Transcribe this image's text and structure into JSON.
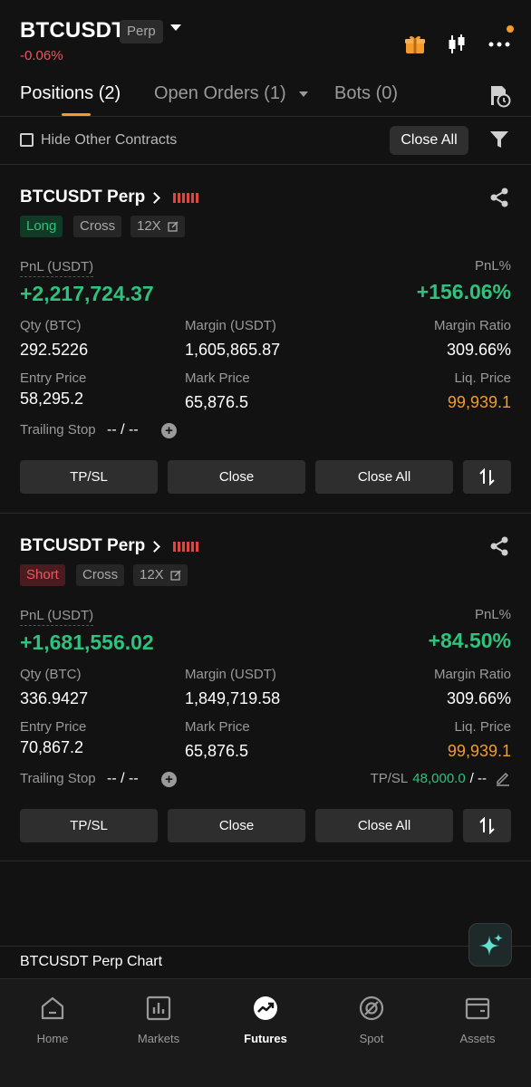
{
  "header": {
    "symbol": "BTCUSDT",
    "perp_badge": "Perp",
    "change": "-0.06%",
    "icons": [
      "gift-icon",
      "candlestick-icon",
      "more-icon"
    ]
  },
  "tabs": [
    {
      "label": "Positions (2)",
      "active": true
    },
    {
      "label": "Open Orders (1)",
      "active": false
    },
    {
      "label": "Bots (0)",
      "active": false
    }
  ],
  "filter": {
    "hide_label": "Hide Other Contracts",
    "close_all": "Close All"
  },
  "positions": [
    {
      "title": "BTCUSDT Perp",
      "side": "Long",
      "margin_mode": "Cross",
      "leverage": "12X",
      "pnl_label": "PnL (USDT)",
      "pnl": "+2,217,724.37",
      "pnl_pct_label": "PnL%",
      "pnl_pct": "+156.06%",
      "qty_label": "Qty (BTC)",
      "qty": "292.5226",
      "margin_label": "Margin (USDT)",
      "margin": "1,605,865.87",
      "margin_ratio_label": "Margin Ratio",
      "margin_ratio": "309.66%",
      "entry_label": "Entry Price",
      "entry": "58,295.2",
      "mark_label": "Mark Price",
      "mark": "65,876.5",
      "liq_label": "Liq. Price",
      "liq": "99,939.1",
      "trailing_label": "Trailing Stop",
      "trailing_value": "-- / --",
      "tpsl_label": "",
      "tpsl_tp": "",
      "tpsl_sl": "",
      "buttons": {
        "tpsl": "TP/SL",
        "close": "Close",
        "close_all": "Close All"
      }
    },
    {
      "title": "BTCUSDT Perp",
      "side": "Short",
      "margin_mode": "Cross",
      "leverage": "12X",
      "pnl_label": "PnL (USDT)",
      "pnl": "+1,681,556.02",
      "pnl_pct_label": "PnL%",
      "pnl_pct": "+84.50%",
      "qty_label": "Qty (BTC)",
      "qty": "336.9427",
      "margin_label": "Margin (USDT)",
      "margin": "1,849,719.58",
      "margin_ratio_label": "Margin Ratio",
      "margin_ratio": "309.66%",
      "entry_label": "Entry Price",
      "entry": "70,867.2",
      "mark_label": "Mark Price",
      "mark": "65,876.5",
      "liq_label": "Liq. Price",
      "liq": "99,939.1",
      "trailing_label": "Trailing Stop",
      "trailing_value": "-- / --",
      "tpsl_label": "TP/SL",
      "tpsl_tp": "48,000.0",
      "tpsl_sl": "/ --",
      "buttons": {
        "tpsl": "TP/SL",
        "close": "Close",
        "close_all": "Close All"
      }
    }
  ],
  "chart_label": "BTCUSDT Perp Chart",
  "nav": [
    {
      "label": "Home",
      "active": false
    },
    {
      "label": "Markets",
      "active": false
    },
    {
      "label": "Futures",
      "active": true
    },
    {
      "label": "Spot",
      "active": false
    },
    {
      "label": "Assets",
      "active": false
    }
  ],
  "colors": {
    "accent": "#f39c2b",
    "positive": "#2ec27e",
    "negative": "#f0555d",
    "background": "#121212"
  }
}
